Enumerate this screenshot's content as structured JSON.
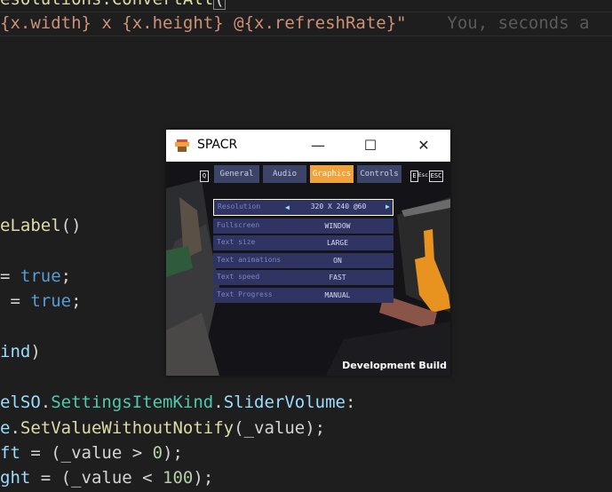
{
  "editor": {
    "line0": "esolutions.ConvertAll",
    "line1": {
      "p1": "{x.width}",
      "p2": " x ",
      "p3": "{x.height}",
      "p4": " @",
      "p5": "{x.refreshRate}",
      "p6": "\"",
      "blame": "You, seconds a"
    },
    "line2": {
      "fn": "eLabel",
      "rest": "()"
    },
    "line3": {
      "op": "= ",
      "kw": "true",
      "end": ";"
    },
    "line4": {
      "op": " = ",
      "kw": "true",
      "end": ";"
    },
    "line5": {
      "var": "ind",
      "end": ")"
    },
    "line6": {
      "var": "elSO",
      "dot1": ".",
      "cls": "SettingsItemKind",
      "dot2": ".",
      "var2": "SliderVolume",
      "end": ":"
    },
    "line7": {
      "var": "e",
      "dot": ".",
      "fn": "SetValueWithoutNotify",
      "rest": "(_value);"
    },
    "line8": {
      "var": "ft",
      "rest": " = (_value > ",
      "num": "0",
      "end": ");"
    },
    "line9": {
      "var": "ght",
      "rest": " = (_value < ",
      "num": "100",
      "end": ");"
    }
  },
  "window": {
    "title": "SPACR",
    "minimize": "—",
    "maximize": "☐",
    "close": "✕"
  },
  "game": {
    "left_key": "Q",
    "tabs": [
      {
        "label": "General"
      },
      {
        "label": "Audio"
      },
      {
        "label": "Graphics"
      },
      {
        "label": "Controls"
      }
    ],
    "right_key": "E",
    "esc_label": "Esc",
    "esc_key": "ESC",
    "rows": [
      {
        "label": "Resolution",
        "value": "320 X 240 @60"
      },
      {
        "label": "Fullscreen",
        "value": "WINDOW"
      },
      {
        "label": "Text size",
        "value": "LARGE"
      },
      {
        "label": "Text animations",
        "value": "ON"
      },
      {
        "label": "Text speed",
        "value": "FAST"
      },
      {
        "label": "Text Progress",
        "value": "MANUAL"
      }
    ],
    "arrow_left": "◀",
    "arrow_right": "▶",
    "dev_build": "Development Build"
  },
  "colors": {
    "accent": "#f0a33a",
    "tab": "#3c4468",
    "row": "#2f3462"
  }
}
